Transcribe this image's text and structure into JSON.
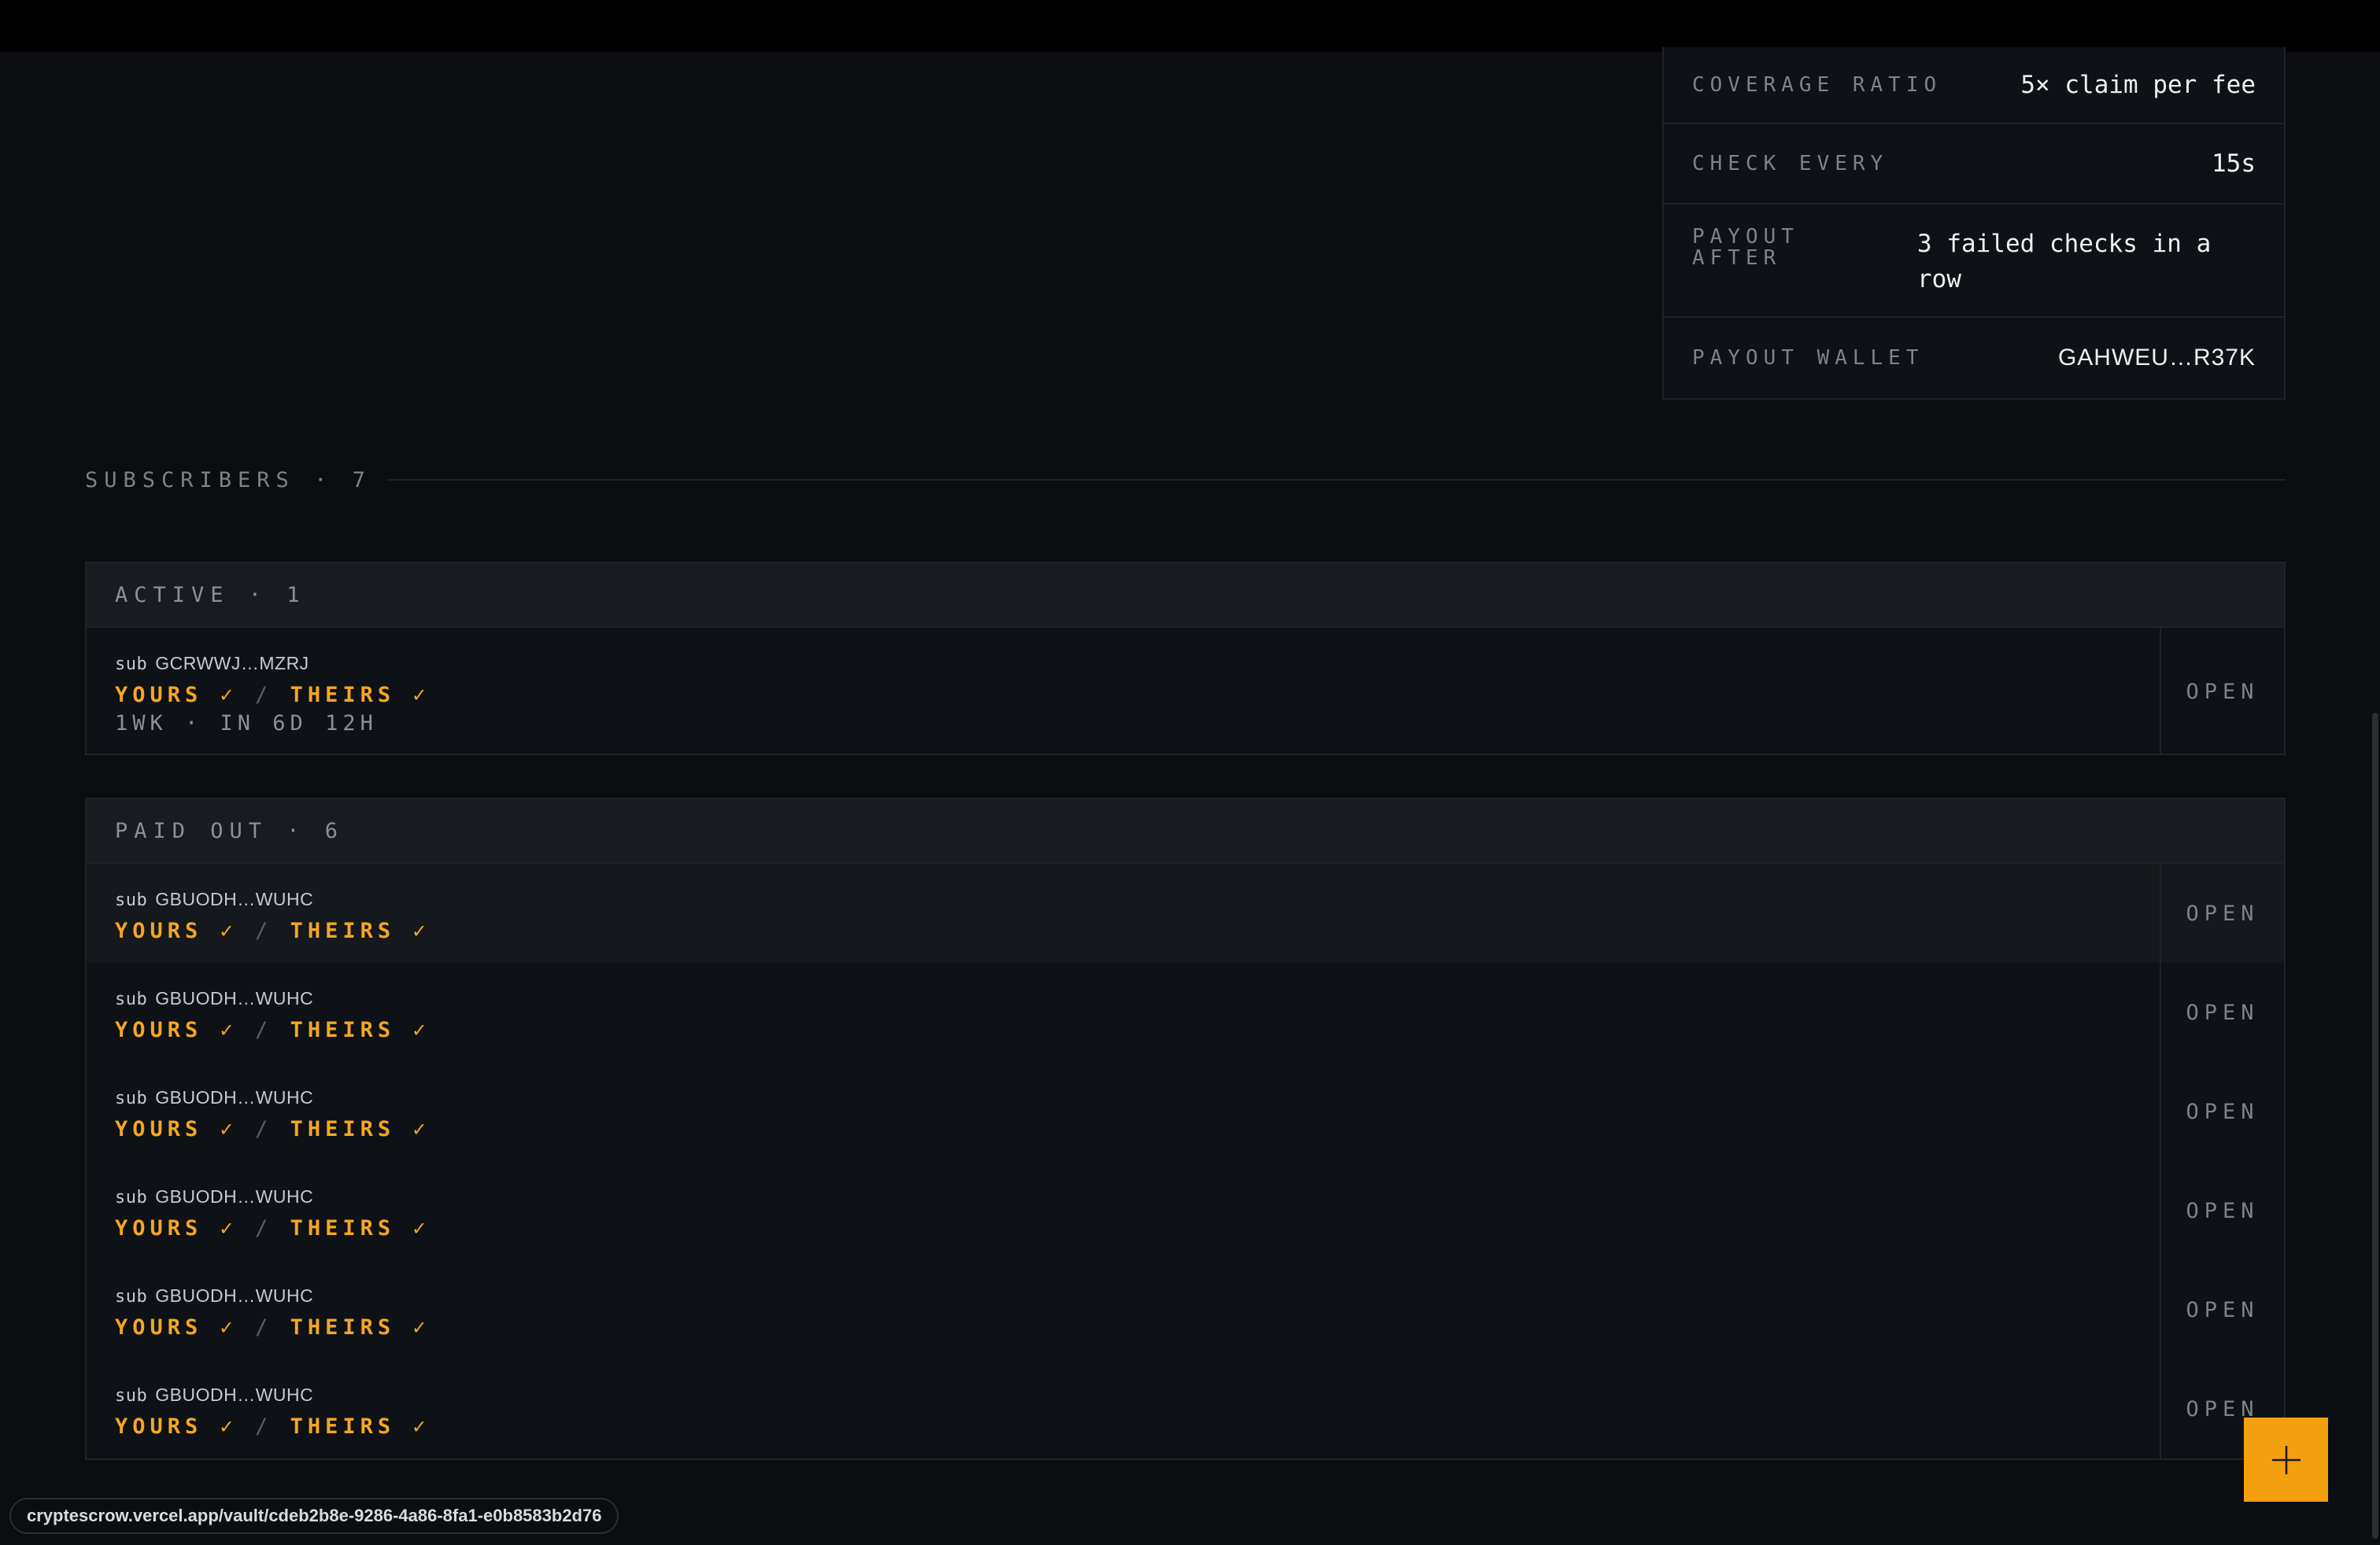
{
  "terms": {
    "rows": [
      {
        "label": "COVERAGE RATIO",
        "value": "5× claim per fee"
      },
      {
        "label": "CHECK EVERY",
        "value": "15s"
      },
      {
        "label": "PAYOUT AFTER",
        "value": "3 failed checks in a row"
      },
      {
        "label": "PAYOUT WALLET",
        "value": "GAHWEU…R37K"
      }
    ]
  },
  "subscribers": {
    "heading": "SUBSCRIBERS · 7",
    "active": {
      "header": "ACTIVE · 1",
      "items": [
        {
          "prefix": "sub",
          "id": "GCRWWJ…MZRJ",
          "yours": "YOURS ✓",
          "sep": " / ",
          "theirs": "THEIRS ✓",
          "meta": "1WK · IN 6D 12H",
          "action": "OPEN"
        }
      ]
    },
    "paid_out": {
      "header": "PAID OUT · 6",
      "items": [
        {
          "prefix": "sub",
          "id": "GBUODH…WUHC",
          "yours": "YOURS ✓",
          "sep": " / ",
          "theirs": "THEIRS ✓",
          "action": "OPEN"
        },
        {
          "prefix": "sub",
          "id": "GBUODH…WUHC",
          "yours": "YOURS ✓",
          "sep": " / ",
          "theirs": "THEIRS ✓",
          "action": "OPEN"
        },
        {
          "prefix": "sub",
          "id": "GBUODH…WUHC",
          "yours": "YOURS ✓",
          "sep": " / ",
          "theirs": "THEIRS ✓",
          "action": "OPEN"
        },
        {
          "prefix": "sub",
          "id": "GBUODH…WUHC",
          "yours": "YOURS ✓",
          "sep": " / ",
          "theirs": "THEIRS ✓",
          "action": "OPEN"
        },
        {
          "prefix": "sub",
          "id": "GBUODH…WUHC",
          "yours": "YOURS ✓",
          "sep": " / ",
          "theirs": "THEIRS ✓",
          "action": "OPEN"
        },
        {
          "prefix": "sub",
          "id": "GBUODH…WUHC",
          "yours": "YOURS ✓",
          "sep": " / ",
          "theirs": "THEIRS ✓",
          "action": "OPEN"
        }
      ]
    }
  },
  "fab": {
    "icon": "plus-icon"
  },
  "status_url": "cryptescrow.vercel.app/vault/cdeb2b8e-9286-4a86-8fa1-e0b8583b2d76",
  "colors": {
    "accent": "#f5a00f",
    "ok": "#f5a623",
    "background": "#0b0d10"
  }
}
